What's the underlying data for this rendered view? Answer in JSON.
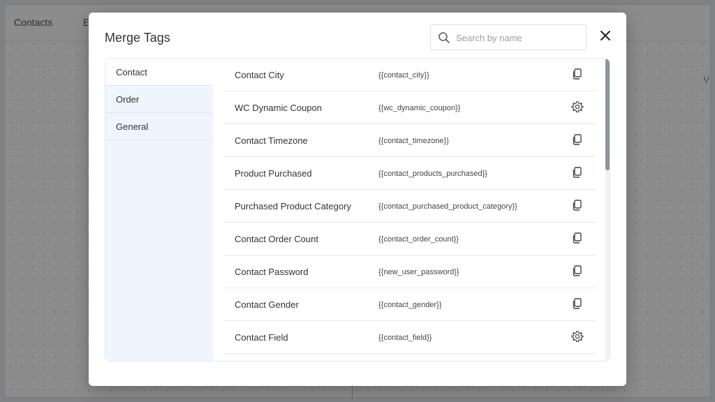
{
  "background": {
    "tabs": [
      "Contacts",
      "E"
    ]
  },
  "modal": {
    "title": "Merge Tags",
    "search": {
      "placeholder": "Search by name",
      "value": ""
    },
    "sidebar": {
      "items": [
        {
          "label": "Contact",
          "active": true
        },
        {
          "label": "Order",
          "active": false
        },
        {
          "label": "General",
          "active": false
        }
      ]
    },
    "tags": [
      {
        "name": "Contact City",
        "tag": "{{contact_city}}",
        "action": "copy-icon"
      },
      {
        "name": "WC Dynamic Coupon",
        "tag": "{{wc_dynamic_coupon}}",
        "action": "gear-icon"
      },
      {
        "name": "Contact Timezone",
        "tag": "{{contact_timezone}}",
        "action": "copy-icon"
      },
      {
        "name": "Product Purchased",
        "tag": "{{contact_products_purchased}}",
        "action": "copy-icon"
      },
      {
        "name": "Purchased Product Category",
        "tag": "{{contact_purchased_product_category}}",
        "action": "copy-icon"
      },
      {
        "name": "Contact Order Count",
        "tag": "{{contact_order_count}}",
        "action": "copy-icon"
      },
      {
        "name": "Contact Password",
        "tag": "{{new_user_password}}",
        "action": "copy-icon"
      },
      {
        "name": "Contact Gender",
        "tag": "{{contact_gender}}",
        "action": "copy-icon"
      },
      {
        "name": "Contact Field",
        "tag": "{{contact_field}}",
        "action": "gear-icon"
      }
    ]
  },
  "colors": {
    "sidebar_bg": "#eef5fd",
    "overlay": "rgba(0,0,0,0.45)",
    "text": "#333333"
  }
}
